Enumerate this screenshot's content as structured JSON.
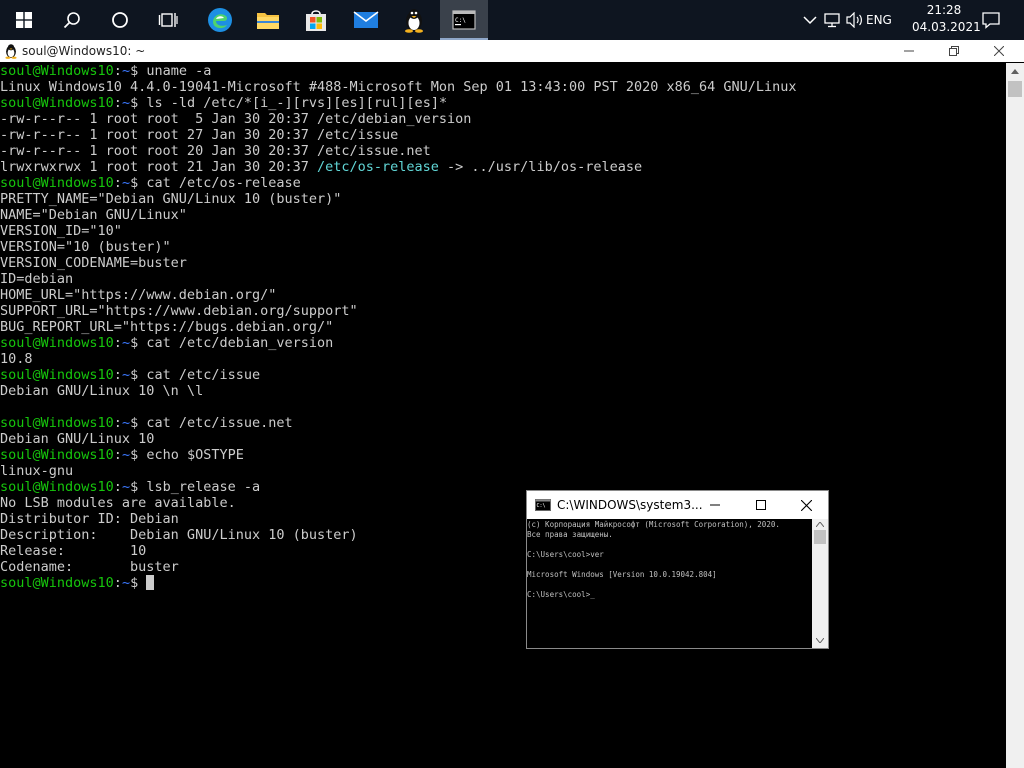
{
  "taskbar": {
    "language": "ENG",
    "time": "21:28",
    "date": "04.03.2021"
  },
  "wsl": {
    "title": "soul@Windows10: ~",
    "lines": [
      {
        "prompt": true,
        "cmd": " uname -a"
      },
      {
        "text": "Linux Windows10 4.4.0-19041-Microsoft #488-Microsoft Mon Sep 01 13:43:00 PST 2020 x86_64 GNU/Linux"
      },
      {
        "prompt": true,
        "cmd": " ls -ld /etc/*[i_-][rvs][es][rul][es]*"
      },
      {
        "text": "-rw-r--r-- 1 root root  5 Jan 30 20:37 /etc/debian_version"
      },
      {
        "text": "-rw-r--r-- 1 root root 27 Jan 30 20:37 /etc/issue"
      },
      {
        "text": "-rw-r--r-- 1 root root 20 Jan 30 20:37 /etc/issue.net"
      },
      {
        "text": "lrwxrwxrwx 1 root root 21 Jan 30 20:37 ",
        "link": "/etc/os-release",
        "tail": " -> ../usr/lib/os-release"
      },
      {
        "prompt": true,
        "cmd": " cat /etc/os-release"
      },
      {
        "text": "PRETTY_NAME=\"Debian GNU/Linux 10 (buster)\""
      },
      {
        "text": "NAME=\"Debian GNU/Linux\""
      },
      {
        "text": "VERSION_ID=\"10\""
      },
      {
        "text": "VERSION=\"10 (buster)\""
      },
      {
        "text": "VERSION_CODENAME=buster"
      },
      {
        "text": "ID=debian"
      },
      {
        "text": "HOME_URL=\"https://www.debian.org/\""
      },
      {
        "text": "SUPPORT_URL=\"https://www.debian.org/support\""
      },
      {
        "text": "BUG_REPORT_URL=\"https://bugs.debian.org/\""
      },
      {
        "prompt": true,
        "cmd": " cat /etc/debian_version"
      },
      {
        "text": "10.8"
      },
      {
        "prompt": true,
        "cmd": " cat /etc/issue"
      },
      {
        "text": "Debian GNU/Linux 10 \\n \\l"
      },
      {
        "text": ""
      },
      {
        "prompt": true,
        "cmd": " cat /etc/issue.net"
      },
      {
        "text": "Debian GNU/Linux 10"
      },
      {
        "prompt": true,
        "cmd": " echo $OSTYPE"
      },
      {
        "text": "linux-gnu"
      },
      {
        "prompt": true,
        "cmd": " lsb_release -a"
      },
      {
        "text": "No LSB modules are available."
      },
      {
        "text": "Distributor ID: Debian"
      },
      {
        "text": "Description:    Debian GNU/Linux 10 (buster)"
      },
      {
        "text": "Release:        10"
      },
      {
        "text": "Codename:       buster"
      },
      {
        "prompt": true,
        "cmd": ""
      }
    ],
    "prompt_user": "soul@Windows10",
    "prompt_sep": ":",
    "prompt_path": "~",
    "prompt_end": "$"
  },
  "cmd": {
    "title": "C:\\WINDOWS\\system3...",
    "lines": [
      "(c) Корпорация Майкрософт (Microsoft Corporation), 2020.",
      "Все права защищены.",
      "",
      "C:\\Users\\cool>ver",
      "",
      "Microsoft Windows [Version 10.0.19042.804]",
      "",
      "C:\\Users\\cool>_"
    ]
  },
  "colors": {
    "prompt_user": "#16c60c",
    "prompt_path": "#3b78ff",
    "link": "#61d6d6",
    "taskbar": "#0e1520"
  }
}
